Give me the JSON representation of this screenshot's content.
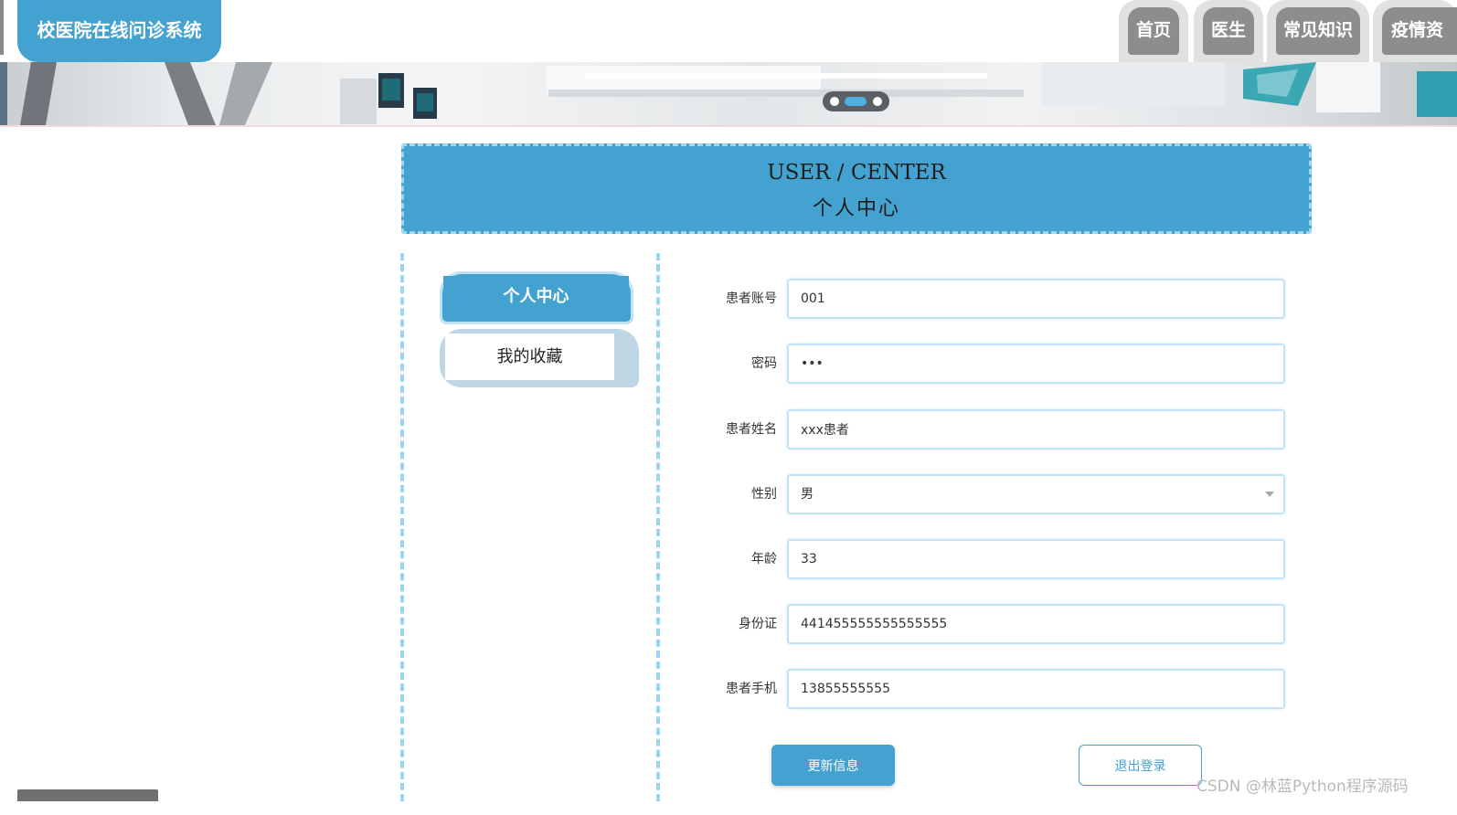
{
  "header": {
    "logo_text": "校医院在线问诊系统",
    "nav": [
      {
        "label": "首页"
      },
      {
        "label": "医生"
      },
      {
        "label": "常见知识"
      },
      {
        "label": "疫情资"
      }
    ]
  },
  "banner": {
    "slides": 3,
    "active_slide": 2
  },
  "title": {
    "en": "USER / CENTER",
    "zh": "个人中心"
  },
  "sidebar": {
    "items": [
      {
        "label": "个人中心",
        "active": true
      },
      {
        "label": "我的收藏",
        "active": false
      }
    ]
  },
  "form": {
    "account_label": "患者账号",
    "account_value": "001",
    "password_label": "密码",
    "password_value": "•••",
    "name_label": "患者姓名",
    "name_value": "xxx患者",
    "gender_label": "性别",
    "gender_value": "男",
    "age_label": "年龄",
    "age_value": "33",
    "idcard_label": "身份证",
    "idcard_value": "441455555555555555",
    "phone_label": "患者手机",
    "phone_value": "13855555555"
  },
  "actions": {
    "update_label": "更新信息",
    "logout_label": "退出登录"
  },
  "watermark": "CSDN @林蓝Python程序源码",
  "colors": {
    "primary": "#44a2d0",
    "border_light": "#9fd6f2",
    "nav_gray": "#8d8d8d"
  }
}
